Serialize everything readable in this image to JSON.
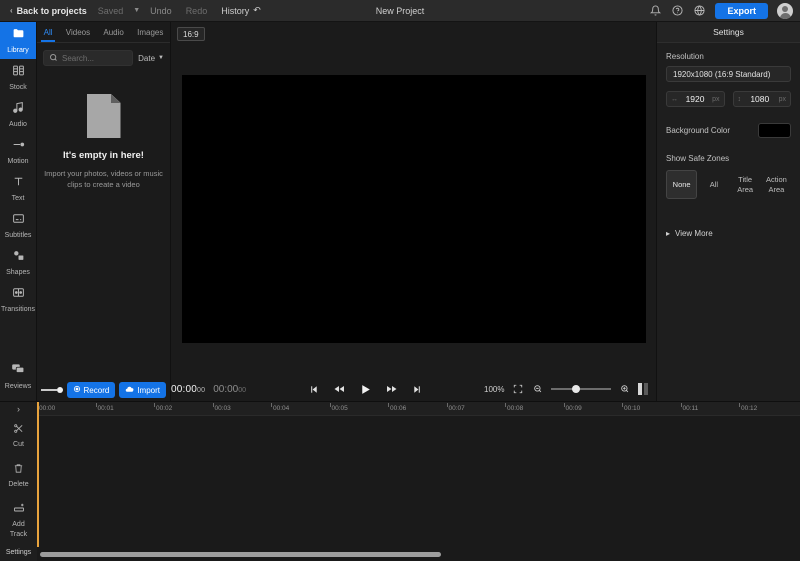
{
  "topbar": {
    "back_label": "Back to projects",
    "back_icon": "chevron-left-icon",
    "saved_label": "Saved",
    "undo_label": "Undo",
    "redo_label": "Redo",
    "history_label": "History",
    "history_icon": "undo-clock-icon",
    "project_title": "New Project",
    "bell_icon": "bell-icon",
    "help_icon": "help-circle-icon",
    "globe_icon": "globe-icon",
    "export_label": "Export",
    "avatar_icon": "user-avatar-icon",
    "accent": "#1473e6"
  },
  "sidebar": {
    "items": [
      {
        "label": "Library",
        "icon": "folder-icon",
        "active": true
      },
      {
        "label": "Stock",
        "icon": "stock-film-icon",
        "active": false
      },
      {
        "label": "Audio",
        "icon": "music-note-icon",
        "active": false
      },
      {
        "label": "Motion",
        "icon": "motion-path-icon",
        "active": false
      },
      {
        "label": "Text",
        "icon": "text-t-icon",
        "active": false
      },
      {
        "label": "Subtitles",
        "icon": "subtitles-icon",
        "active": false
      },
      {
        "label": "Shapes",
        "icon": "shapes-icon",
        "active": false
      },
      {
        "label": "Transitions",
        "icon": "transitions-icon",
        "active": false
      },
      {
        "label": "Reviews",
        "icon": "reviews-icon",
        "active": false
      }
    ]
  },
  "timeline_rail": {
    "expand_icon": "chevron-right-icon",
    "items": [
      {
        "label": "Cut",
        "icon": "scissors-icon"
      },
      {
        "label": "Delete",
        "icon": "trash-icon"
      },
      {
        "label": "Add\nTrack",
        "icon": "add-track-icon"
      }
    ],
    "cut_label": "Cut",
    "delete_label": "Delete",
    "add_track_label_1": "Add",
    "add_track_label_2": "Track",
    "settings_label": "Settings"
  },
  "library": {
    "tabs": [
      {
        "label": "All",
        "active": true
      },
      {
        "label": "Videos",
        "active": false
      },
      {
        "label": "Audio",
        "active": false
      },
      {
        "label": "Images",
        "active": false
      }
    ],
    "search": {
      "value": "",
      "placeholder": "Search...",
      "icon": "search-icon"
    },
    "sort": {
      "label": "Date",
      "icon": "chevron-down-icon"
    },
    "empty_icon": "document-placeholder-icon",
    "empty_title": "It's empty in here!",
    "empty_subtitle": "Import your photos, videos or music clips to create a video",
    "record_label": "Record",
    "record_icon": "record-dot-icon",
    "import_label": "Import",
    "import_icon": "cloud-upload-icon"
  },
  "preview": {
    "aspect_badge": "16:9",
    "canvas_color": "#000000",
    "current_time": "00:00",
    "current_frames": "00",
    "total_time": "00:00",
    "total_frames": "00",
    "transport": [
      {
        "name": "skip-to-start-icon"
      },
      {
        "name": "rewind-icon"
      },
      {
        "name": "play-icon"
      },
      {
        "name": "fast-forward-icon"
      },
      {
        "name": "skip-to-end-icon"
      }
    ],
    "zoom_level": "100%",
    "fit_icon": "fit-screen-icon",
    "zoom_out_icon": "zoom-out-icon",
    "zoom_in_icon": "zoom-in-icon",
    "split-view_icon": "split-panel-icon"
  },
  "settings": {
    "title": "Settings",
    "resolution_label": "Resolution",
    "resolution_value": "1920x1080 (16:9 Standard)",
    "width_value": "1920",
    "width_unit": "px",
    "width_icon": "width-icon",
    "height_value": "1080",
    "height_unit": "px",
    "height_icon": "height-icon",
    "background_color_label": "Background Color",
    "background_color_value": "#000000",
    "safe_zones_label": "Show Safe Zones",
    "safe_zones": [
      {
        "label": "None",
        "active": true
      },
      {
        "label": "All",
        "active": false
      },
      {
        "label": "Title Area",
        "active": false
      },
      {
        "label": "Action Area",
        "active": false
      }
    ],
    "view_more_label": "View More",
    "view_more_icon": "chevron-right-icon"
  },
  "timeline": {
    "playhead_position": "00:00",
    "ticks": [
      "00:00",
      "00:01",
      "00:02",
      "00:03",
      "00:04",
      "00:05",
      "00:06",
      "00:07",
      "00:08",
      "00:09",
      "00:10",
      "00:11",
      "00:12"
    ],
    "playhead_color": "#e8a33d"
  }
}
